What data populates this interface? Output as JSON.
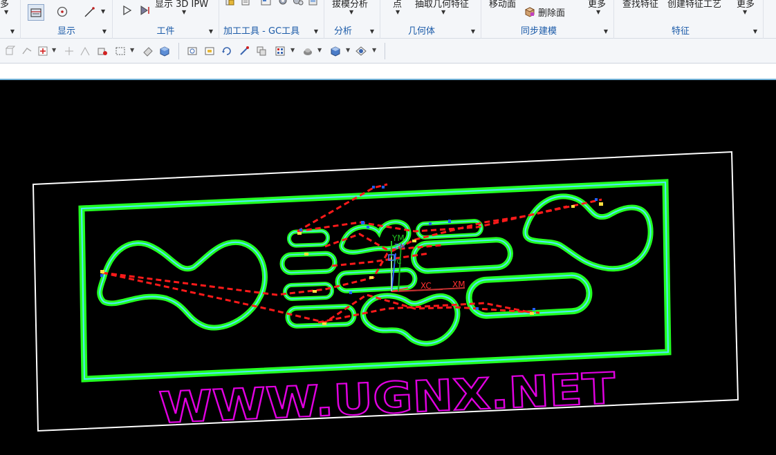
{
  "ribbon": {
    "top_commands": {
      "more_left": "多",
      "show_3d_ipw": "显示 3D IPW",
      "draft_analysis": "拔模分析",
      "point": "点",
      "extract_geometry": "抽取几何特征",
      "move_face": "移动面",
      "find_feature": "查找特征",
      "create_feature_process": "创建特征工艺",
      "more_right_1": "更多",
      "more_right_2": "更多"
    },
    "delete_face": "删除面",
    "groups": {
      "display": "显示",
      "workpiece": "工件",
      "gc_tools": "加工工具 - GC工具",
      "analysis": "分析",
      "geometry": "几何体",
      "sync_modeling": "同步建模",
      "feature": "特征"
    }
  },
  "viewport": {
    "watermark": "WWW.UGNX.NET",
    "axis_labels": {
      "ym": "YM",
      "yc": "YC",
      "xc": "XC",
      "xm": "XM",
      "zm": "ZM"
    },
    "colors": {
      "background": "#000000",
      "part_outline": "#ffffff",
      "pocket_green": "#22ff22",
      "pocket_edge": "#4fe8ff",
      "toolpath": "#ff1a1a",
      "watermark": "#e000e0"
    }
  }
}
